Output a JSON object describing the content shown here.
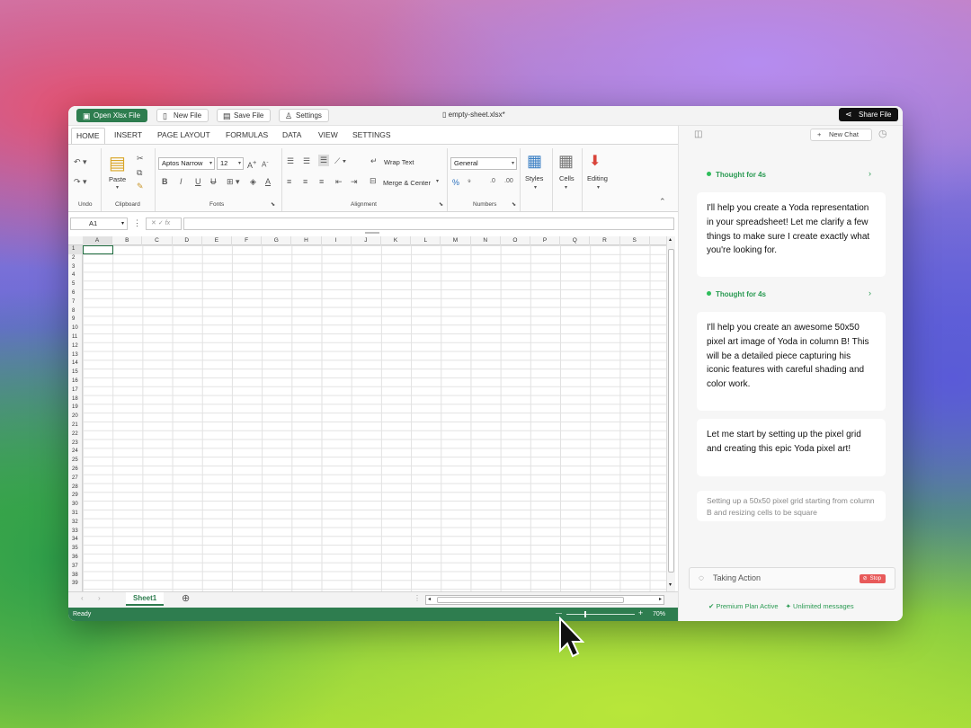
{
  "titlebar": {
    "open_label": "Open Xlsx File",
    "new_label": "New File",
    "save_label": "Save File",
    "settings_label": "Settings",
    "filename": "empty-sheet.xlsx*",
    "share_label": "Share File"
  },
  "ribbon": {
    "tabs": [
      "HOME",
      "INSERT",
      "PAGE LAYOUT",
      "FORMULAS",
      "DATA",
      "VIEW",
      "SETTINGS"
    ],
    "groups": {
      "undo": "Undo",
      "clipboard": "Clipboard",
      "fonts": "Fonts",
      "alignment": "Alignment",
      "numbers": "Numbers"
    },
    "paste": "Paste",
    "font_name": "Aptos Narrow",
    "font_size": "12",
    "wrap_text": "Wrap Text",
    "merge_center": "Merge & Center",
    "number_format": "General",
    "styles": "Styles",
    "cells": "Cells",
    "editing": "Editing"
  },
  "formula": {
    "cell_ref": "A1",
    "fx": "fx",
    "value": ""
  },
  "grid": {
    "columns": [
      "A",
      "B",
      "C",
      "D",
      "E",
      "F",
      "G",
      "H",
      "I",
      "J",
      "K",
      "L",
      "M",
      "N",
      "O",
      "P",
      "Q",
      "R",
      "S"
    ],
    "rows": [
      "1",
      "2",
      "3",
      "4",
      "5",
      "6",
      "7",
      "8",
      "9",
      "10",
      "11",
      "12",
      "13",
      "14",
      "15",
      "16",
      "17",
      "18",
      "19",
      "20",
      "21",
      "22",
      "23",
      "24",
      "25",
      "26",
      "27",
      "28",
      "29",
      "30",
      "31",
      "32",
      "33",
      "34",
      "35",
      "36",
      "37",
      "38",
      "39"
    ]
  },
  "sheets": {
    "active": "Sheet1"
  },
  "status": {
    "state": "Ready",
    "zoom": "70%"
  },
  "chat": {
    "new_chat": "New Chat",
    "thought1": "Thought for 4s",
    "msg1": "I'll help you create a Yoda representation in your spreadsheet! Let me clarify a few things to make sure I create exactly what you're looking for.",
    "thought2": "Thought for 4s",
    "msg2": "I'll help you create an awesome 50x50 pixel art image of Yoda in column B! This will be a detailed piece capturing his iconic features with careful shading and color work.",
    "msg3": "Let me start by setting up the pixel grid and creating this epic Yoda pixel art!",
    "msg4": "Setting up a 50x50 pixel grid starting from column B and resizing cells to be square",
    "action": "Taking Action",
    "stop": "Stop",
    "plan": "Premium Plan Active",
    "unlimited": "Unlimited messages"
  },
  "colors": {
    "accent": "#2e7d4f",
    "thought": "#2a9a52",
    "stop": "#e85a5a"
  }
}
